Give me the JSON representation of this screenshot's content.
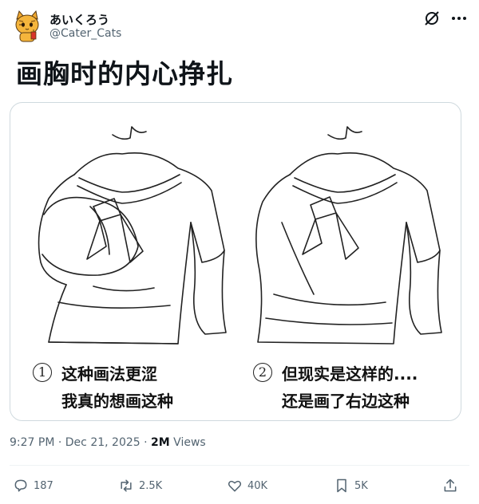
{
  "author": {
    "display_name": "あいくろう",
    "handle": "@Cater_Cats"
  },
  "tweet": {
    "text": "画胸时的内心挣扎"
  },
  "image": {
    "panel_1": {
      "number": "1",
      "caption_line_1": "这种画法更涩",
      "caption_line_2": "我真的想画这种"
    },
    "panel_2": {
      "number": "2",
      "caption_line_1": "但现实是这样的....",
      "caption_line_2": "还是画了右边这种"
    }
  },
  "meta": {
    "time": "9:27 PM",
    "separator": "·",
    "date": "Dec 21, 2025",
    "views_count": "2M",
    "views_label": "Views"
  },
  "actions": {
    "replies": "187",
    "reposts": "2.5K",
    "likes": "40K",
    "bookmarks": "5K"
  },
  "icons": [
    "grok-icon",
    "more-icon",
    "reply-icon",
    "repost-icon",
    "like-icon",
    "bookmark-icon",
    "share-icon"
  ]
}
